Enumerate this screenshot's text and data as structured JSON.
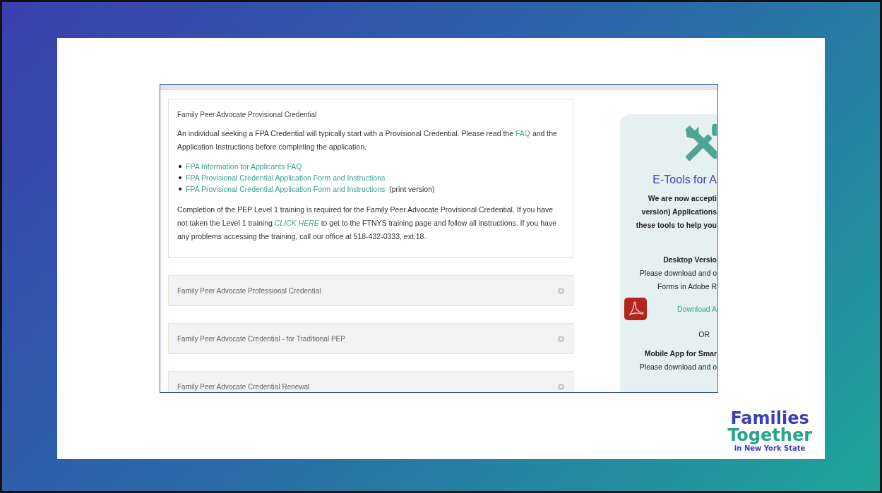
{
  "page": {
    "intro_section": {
      "title": "Family Peer Advocate Provisional Credential",
      "intro": {
        "before": "An individual seeking a FPA Credential will typically start with a Provisional Credential.  Please read the ",
        "link": "FAQ",
        "after": " and the Application Instructions before completing the application."
      },
      "links": [
        {
          "text": "FPA Information for Applicants FAQ"
        },
        {
          "text": "FPA Provisional Credential Application Form and Instructions"
        },
        {
          "text": "FPA Provisional Credential Application Form and Instructions",
          "note": "(print version)"
        }
      ],
      "training": {
        "before": "Completion of the PEP Level 1 training is required for the Family Peer Advocate Provisional Credential. If you have not taken the Level 1 training ",
        "link": "CLICK HERE",
        "after": " to get to the FTNYS training page and follow all instructions.  If you have any problems accessing the training, call our office at 518-432-0333, ext.18."
      }
    },
    "accordions": [
      {
        "title": "Family Peer Advocate Professional Credential",
        "expanded": false
      },
      {
        "title": "Family Peer Advocate Credential - for Traditional PEP",
        "expanded": false
      },
      {
        "title": "Family Peer Advocate Credential Renewal",
        "expanded": false
      }
    ],
    "etools": {
      "heading": "E-Tools for A",
      "lines": [
        "We are now accepti",
        "version) Applications",
        "these tools to help you"
      ],
      "desktop": {
        "title": "Desktop Versio",
        "lines": [
          "Please download and o",
          "Forms in Adobe R"
        ],
        "download": "Download A"
      },
      "separator": "OR",
      "mobile": {
        "title": "Mobile App for Smar",
        "lines": [
          "Please download and o"
        ]
      }
    }
  },
  "logo": {
    "line_1": "Families",
    "line_2": "Together",
    "line_3": "in New York State"
  }
}
